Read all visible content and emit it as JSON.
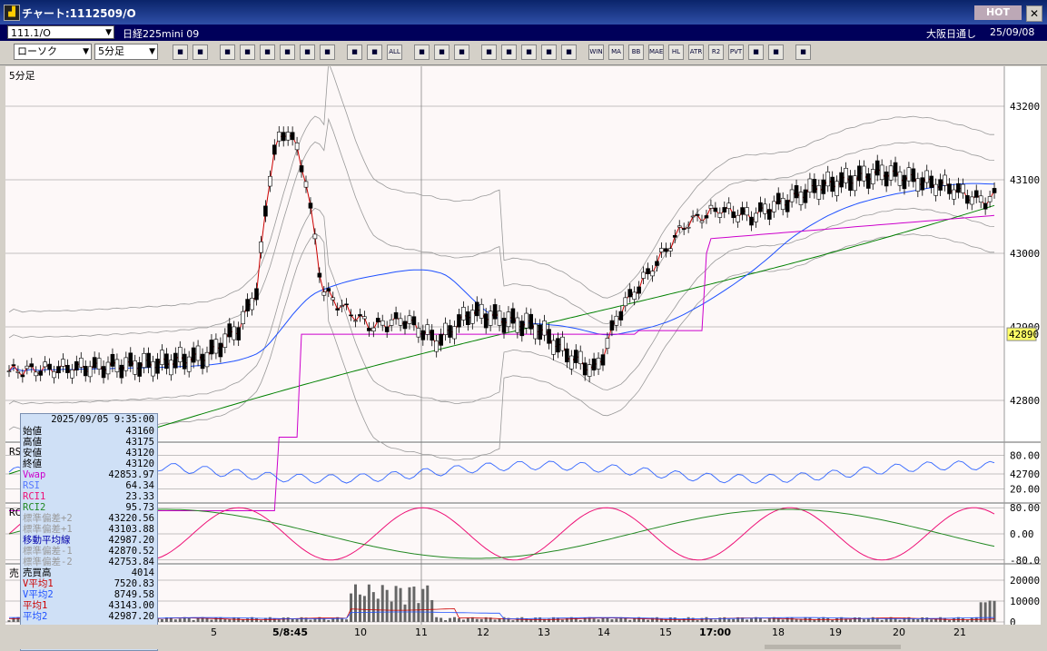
{
  "window": {
    "title": "チャート:1112509/O",
    "hot_label": "HOT",
    "close_label": "✕",
    "logo_icon": "chart-app-icon"
  },
  "infobar": {
    "symbol": "111.1/O",
    "instrument": "日経225mini 09",
    "exchange": "大阪日通し",
    "date": "25/09/08"
  },
  "toolbar": {
    "chart_type": "ローソク",
    "interval": "5分足",
    "buttons": [
      "zoom",
      "window",
      "pencil",
      "eraser",
      "pointer",
      "redo",
      "list",
      "trash",
      "split",
      "split2",
      "ALL",
      "settings",
      "draw",
      "palette",
      "import",
      "search",
      "bar",
      "signal",
      "blank",
      "WIN",
      "MA",
      "BB",
      "MAE",
      "HL",
      "ATR",
      "R2",
      "PVT",
      "box",
      "Log",
      "export"
    ]
  },
  "chart": {
    "interval_label": "5分足",
    "price_ticks": [
      "43200",
      "43100",
      "43000",
      "42900",
      "42800",
      "42700"
    ],
    "current_price": "42890",
    "rsi_ticks": [
      "80.00",
      "20.00"
    ],
    "rci_ticks": [
      "80.00",
      "0.00",
      "-80.00"
    ],
    "volume_ticks": [
      "20000",
      "10000",
      "0"
    ],
    "rsi_label": "RS",
    "rci_label": "RC",
    "volume_label": "売",
    "colors": {
      "ma_fast": "#cc0000",
      "ma_mid": "#1e50ff",
      "ma_long": "#008000",
      "vwap": "#cc00cc",
      "band": "#999999",
      "rsi": "#3366ff",
      "rci1": "#ee1177",
      "rci2": "#228822",
      "candle_up": "#ffffff",
      "candle_down": "#000000",
      "grid": "#888888"
    }
  },
  "time_axis": [
    {
      "label": "5"
    },
    {
      "label": "5/8:45"
    },
    {
      "label": "10"
    },
    {
      "label": "11"
    },
    {
      "label": "12"
    },
    {
      "label": "13"
    },
    {
      "label": "14"
    },
    {
      "label": "15"
    },
    {
      "label": "17:00"
    },
    {
      "label": "18"
    },
    {
      "label": "19"
    },
    {
      "label": "20"
    },
    {
      "label": "21"
    }
  ],
  "data_panel": {
    "datetime": "2025/09/05 9:35:00",
    "rows": [
      {
        "k": "始値",
        "v": "43160",
        "color": "#000000"
      },
      {
        "k": "高値",
        "v": "43175",
        "color": "#000000"
      },
      {
        "k": "安値",
        "v": "43120",
        "color": "#000000"
      },
      {
        "k": "終値",
        "v": "43120",
        "color": "#000000"
      },
      {
        "k": "Vwap",
        "v": "42853.97",
        "color": "#cc00cc"
      },
      {
        "k": "RSI",
        "v": "64.34",
        "color": "#5577ff"
      },
      {
        "k": "RCI1",
        "v": "23.33",
        "color": "#ee1177"
      },
      {
        "k": "RCI2",
        "v": "95.73",
        "color": "#228822"
      },
      {
        "k": "標準偏差+2",
        "v": "43220.56",
        "color": "#999999"
      },
      {
        "k": "標準偏差+1",
        "v": "43103.88",
        "color": "#999999"
      },
      {
        "k": "移動平均線",
        "v": "42987.20",
        "color": "#0000aa"
      },
      {
        "k": "標準偏差-1",
        "v": "42870.52",
        "color": "#999999"
      },
      {
        "k": "標準偏差-2",
        "v": "42753.84",
        "color": "#999999"
      },
      {
        "k": "売買高",
        "v": "4014",
        "color": "#000000"
      },
      {
        "k": "V平均1",
        "v": "7520.83",
        "color": "#cc0000"
      },
      {
        "k": "V平均2",
        "v": "8749.58",
        "color": "#1e50ff"
      },
      {
        "k": "平均1",
        "v": "43143.00",
        "color": "#cc0000"
      },
      {
        "k": "平均2",
        "v": "42987.20",
        "color": "#1e50ff"
      }
    ]
  }
}
